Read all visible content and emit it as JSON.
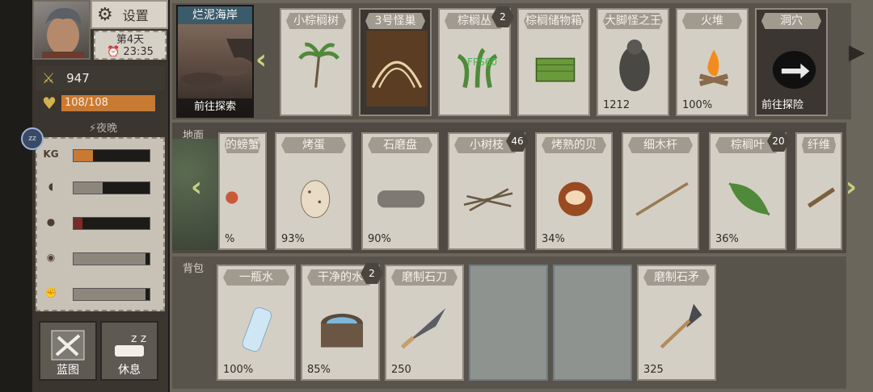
{
  "player": {
    "settings_label": "设置",
    "day": "第4天",
    "time": "23:35",
    "attack": "947",
    "hp_text": "108/108",
    "hp_fraction": 1.0,
    "phase": "夜晚"
  },
  "needs": [
    {
      "icon": "weight-icon",
      "fill": 0.25,
      "color": "#c87a33"
    },
    {
      "icon": "bread-icon",
      "fill": 0.38,
      "color": "#8c877c"
    },
    {
      "icon": "blood-drop-icon",
      "fill": 0.12,
      "color": "#7a2a2a"
    },
    {
      "icon": "eye-icon",
      "fill": 0.95,
      "color": "#8c877c"
    },
    {
      "icon": "muscle-icon",
      "fill": 0.95,
      "color": "#8c877c"
    }
  ],
  "bottom_buttons": [
    {
      "label": "蓝图",
      "icon": "blueprint-icon"
    },
    {
      "label": "休息",
      "icon": "sleep-icon"
    }
  ],
  "location": {
    "title": "烂泥海岸",
    "action": "前往探索"
  },
  "top_cards": [
    {
      "title": "小棕榈树",
      "footer": "",
      "badge": ""
    },
    {
      "title": "3号怪巢",
      "footer": "",
      "badge": ""
    },
    {
      "title": "棕榈丛",
      "footer": "",
      "badge": "2"
    },
    {
      "title": "棕榈储物箱",
      "footer": "",
      "badge": ""
    },
    {
      "title": "大脚怪之王",
      "footer": "1212",
      "badge": ""
    },
    {
      "title": "火堆",
      "footer": "100%",
      "badge": ""
    },
    {
      "title": "洞穴",
      "footer": "前往探险",
      "badge": ""
    }
  ],
  "ground": {
    "label": "地面",
    "cards": [
      {
        "title": "的螃蟹",
        "footer": "%",
        "badge": ""
      },
      {
        "title": "烤蛋",
        "footer": "93%",
        "badge": ""
      },
      {
        "title": "石磨盘",
        "footer": "90%",
        "badge": ""
      },
      {
        "title": "小树枝",
        "footer": "",
        "badge": "46"
      },
      {
        "title": "烤熟的贝",
        "footer": "34%",
        "badge": ""
      },
      {
        "title": "细木杆",
        "footer": "",
        "badge": ""
      },
      {
        "title": "棕榈叶",
        "footer": "36%",
        "badge": "20"
      },
      {
        "title": "纤维",
        "footer": "",
        "badge": ""
      }
    ]
  },
  "pack": {
    "label": "背包",
    "cards": [
      {
        "title": "一瓶水",
        "footer": "100%",
        "badge": ""
      },
      {
        "title": "干净的水",
        "footer": "85%",
        "badge": "2"
      },
      {
        "title": "磨制石刀",
        "footer": "250",
        "badge": ""
      },
      {
        "title": "",
        "footer": "",
        "badge": ""
      },
      {
        "title": "",
        "footer": "",
        "badge": ""
      },
      {
        "title": "磨制石矛",
        "footer": "325",
        "badge": ""
      }
    ]
  },
  "overlay": {
    "fps": "FPS60",
    "circle_text": "zz"
  }
}
